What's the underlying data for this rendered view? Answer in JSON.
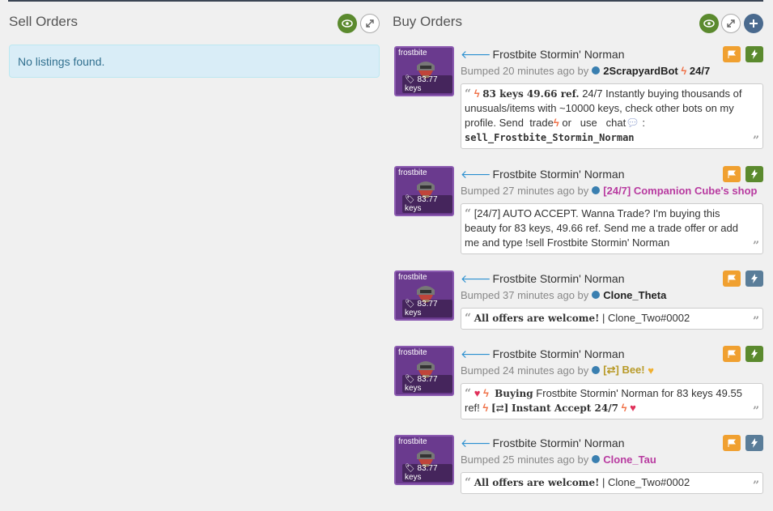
{
  "sell": {
    "title": "Sell Orders",
    "empty_text": "No listings found."
  },
  "buy": {
    "title": "Buy Orders"
  },
  "listings": [
    {
      "quality": "frostbite",
      "price": "83.77 keys",
      "item_name": "Frostbite Stormin' Norman",
      "bumped": "Bumped 20 minutes ago by",
      "user": "2ScrapyardBot",
      "user_suffix": "24/7",
      "comment_a": "83 keys 49.66 ref.",
      "comment_b": "24/7 Instantly buying thousands of unusuals/items with ~10000 keys, check other bots on my profile. Send",
      "comment_c": "trade",
      "comment_d": "or",
      "comment_e": "use",
      "comment_f": "chat",
      "comment_g": ":",
      "comment_h": "sell_Frostbite_Stormin_Norman"
    },
    {
      "quality": "frostbite",
      "price": "83.77 keys",
      "item_name": "Frostbite Stormin' Norman",
      "bumped": "Bumped 27 minutes ago by",
      "user": "[24/7] Companion Cube's shop",
      "comment_a": "[24/7] AUTO ACCEPT. Wanna Trade? I'm buying this beauty for 83 keys, 49.66 ref. Send me a trade offer or add me and type !sell Frostbite Stormin' Norman"
    },
    {
      "quality": "frostbite",
      "price": "83.77 keys",
      "item_name": "Frostbite Stormin' Norman",
      "bumped": "Bumped 37 minutes ago by",
      "user": "Clone_Theta",
      "comment_a": "All offers are welcome!",
      "comment_b": "| Clone_Two#0002"
    },
    {
      "quality": "frostbite",
      "price": "83.77 keys",
      "item_name": "Frostbite Stormin' Norman",
      "bumped": "Bumped 24 minutes ago by",
      "user": "[⇄] Bee!",
      "comment_a": "Buying",
      "comment_b": "Frostbite Stormin' Norman for 83 keys 49.55 ref!",
      "comment_c": "[⇄]",
      "comment_d": "Instant Accept 24/7"
    },
    {
      "quality": "frostbite",
      "price": "83.77 keys",
      "item_name": "Frostbite Stormin' Norman",
      "bumped": "Bumped 25 minutes ago by",
      "user": "Clone_Tau",
      "comment_a": "All offers are welcome!",
      "comment_b": "| Clone_Two#0002"
    }
  ]
}
